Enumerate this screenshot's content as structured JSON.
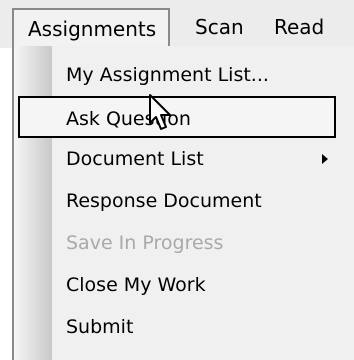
{
  "menubar": {
    "menus": [
      {
        "label": "Assignments",
        "active": true
      },
      {
        "label": "Scan"
      },
      {
        "label": "Read"
      }
    ]
  },
  "dropdown": {
    "items": [
      {
        "label": "My Assignment List..."
      },
      {
        "label": "Ask Question",
        "state": "hover"
      },
      {
        "label": "Document List",
        "has_submenu": true,
        "submenu_icon": "chevron-right-icon"
      },
      {
        "label": "Response Document"
      },
      {
        "label": "Save In Progress",
        "disabled": true
      },
      {
        "label": "Close My Work"
      },
      {
        "label": "Submit"
      }
    ]
  },
  "cursor": {
    "icon": "mouse-pointer-icon"
  }
}
